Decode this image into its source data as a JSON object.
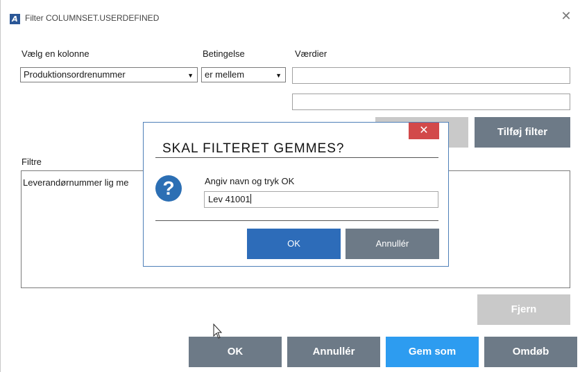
{
  "window": {
    "title": "Filter COLUMNSET.USERDEFINED",
    "app_icon": "app-logo-icon",
    "close_icon": "close-icon",
    "close_glyph": "✕"
  },
  "labels": {
    "column": "Vælg en kolonne",
    "condition": "Betingelse",
    "values": "Værdier",
    "filters": "Filtre"
  },
  "column_select": {
    "value": "Produktionsordrenummer"
  },
  "condition_select": {
    "value": "er mellem"
  },
  "value_inputs": [
    {
      "value": ""
    },
    {
      "value": ""
    }
  ],
  "buttons": {
    "add_filter": "Tilføj filter",
    "remove": "Fjern",
    "ok": "OK",
    "cancel": "Annullér",
    "save_as": "Gem som",
    "rename": "Omdøb"
  },
  "filters_list": [
    "Leverandørnummer lig me"
  ],
  "dialog": {
    "title": "SKAL FILTERET GEMMES?",
    "close_glyph": "✕",
    "icon": "question-icon",
    "prompt": "Angiv navn og tryk OK",
    "input_value": "Lev 41001",
    "ok": "OK",
    "cancel": "Annullér"
  },
  "colors": {
    "dark_button": "#6d7a87",
    "blue_button": "#2d9cf0",
    "disabled_button": "#c9c9c9",
    "dialog_ok": "#2d6cb9",
    "dialog_close": "#d2494a"
  }
}
